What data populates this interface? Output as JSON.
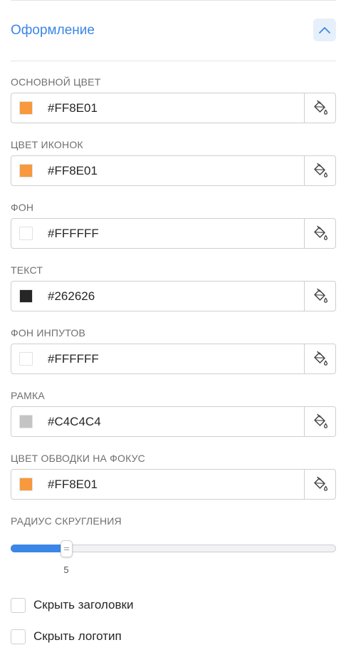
{
  "section": {
    "title": "Оформление",
    "collapse_icon": "chevron-up-icon"
  },
  "fields": [
    {
      "id": "main-color",
      "label": "ОСНОВНОЙ ЦВЕТ",
      "value": "#FF8E01",
      "swatch": "#F7993C"
    },
    {
      "id": "icon-color",
      "label": "ЦВЕТ ИКОНОК",
      "value": "#FF8E01",
      "swatch": "#F7993C"
    },
    {
      "id": "background",
      "label": "ФОН",
      "value": "#FFFFFF",
      "swatch": "#FFFFFF"
    },
    {
      "id": "text",
      "label": "ТЕКСТ",
      "value": "#262626",
      "swatch": "#262626"
    },
    {
      "id": "input-background",
      "label": "ФОН ИНПУТОВ",
      "value": "#FFFFFF",
      "swatch": "#FFFFFF"
    },
    {
      "id": "border",
      "label": "РАМКА",
      "value": "#C4C4C4",
      "swatch": "#C4C4C4"
    },
    {
      "id": "focus-outline",
      "label": "ЦВЕТ ОБВОДКИ НА ФОКУС",
      "value": "#FF8E01",
      "swatch": "#F7993C"
    }
  ],
  "picker_icon": "paint-bucket-icon",
  "radius": {
    "label": "РАДИУС СКРУГЛЕНИЯ",
    "value": 5,
    "value_text": "5",
    "fill_fraction": 0.17
  },
  "checkboxes": [
    {
      "id": "hide-headings",
      "label": "Скрыть заголовки",
      "checked": false
    },
    {
      "id": "hide-logo",
      "label": "Скрыть логотип",
      "checked": false
    }
  ],
  "colors": {
    "accent": "#3B86E6",
    "accent_light": "#E6F0FB",
    "label": "#6F6F6F",
    "border": "#CFCFCF"
  }
}
